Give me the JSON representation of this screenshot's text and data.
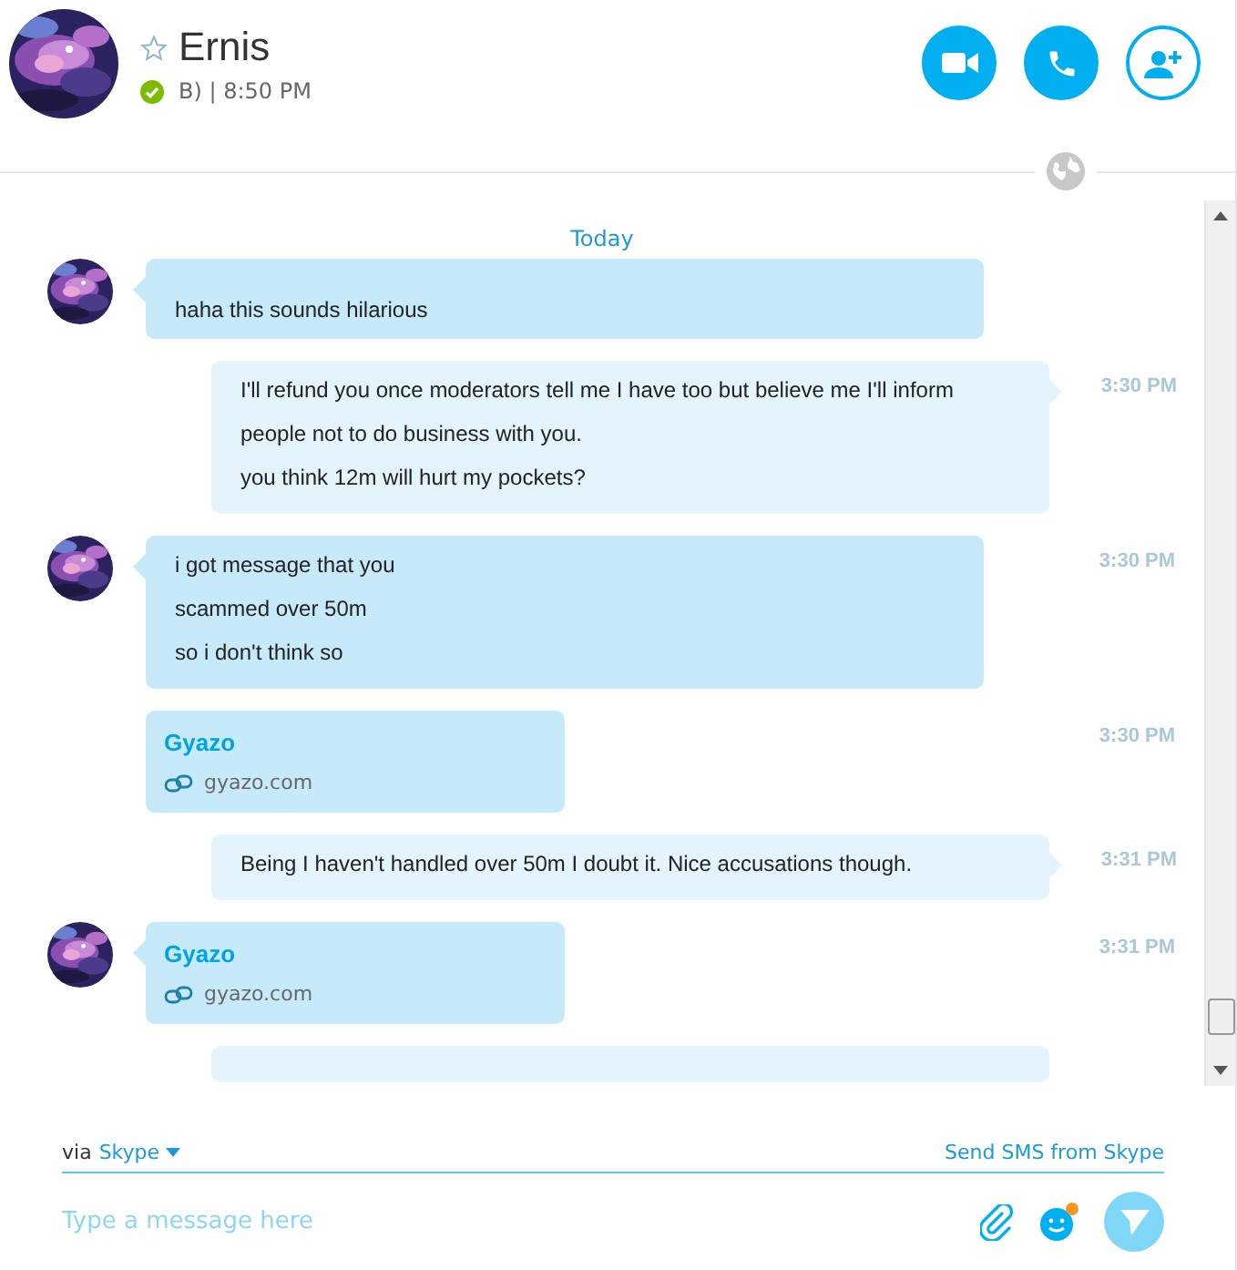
{
  "contact": {
    "name": "Ernis",
    "favorite": false,
    "online": true,
    "mood": "B) | 8:50 PM"
  },
  "call_buttons": [
    {
      "kind": "video"
    },
    {
      "kind": "call"
    },
    {
      "kind": "add_contact"
    }
  ],
  "chat": {
    "date_label": "Today",
    "messages": [
      {
        "outgoing": false,
        "avatar": true,
        "kind": "text",
        "lines": [
          "haha this sounds hilarious"
        ]
      },
      {
        "outgoing": true,
        "avatar": false,
        "kind": "text",
        "lines": [
          "I'll refund you once moderators tell me I have too but believe me I'll inform people not to do business with you.",
          "you think 12m will hurt my pockets?"
        ],
        "time": "3:30 PM"
      },
      {
        "outgoing": false,
        "avatar": true,
        "kind": "text",
        "lines": [
          "i got message that you",
          "scammed over 50m",
          "so i don't think so"
        ],
        "time": "3:30 PM"
      },
      {
        "outgoing": false,
        "avatar": false,
        "kind": "link",
        "title": "Gyazo",
        "url": "gyazo.com",
        "time": "3:30 PM"
      },
      {
        "outgoing": true,
        "avatar": false,
        "kind": "text",
        "lines": [
          "Being I haven't handled over 50m I doubt it. Nice accusations though."
        ],
        "time": "3:31 PM"
      },
      {
        "outgoing": false,
        "avatar": true,
        "kind": "link",
        "title": "Gyazo",
        "url": "gyazo.com",
        "time": "3:31 PM"
      },
      {
        "outgoing": true,
        "avatar": false,
        "kind": "cut_off"
      }
    ]
  },
  "composer": {
    "via_label": "via",
    "service": "Skype",
    "sms_link": "Send SMS from Skype",
    "placeholder": "Type a message here",
    "emoticon_badge": true
  }
}
